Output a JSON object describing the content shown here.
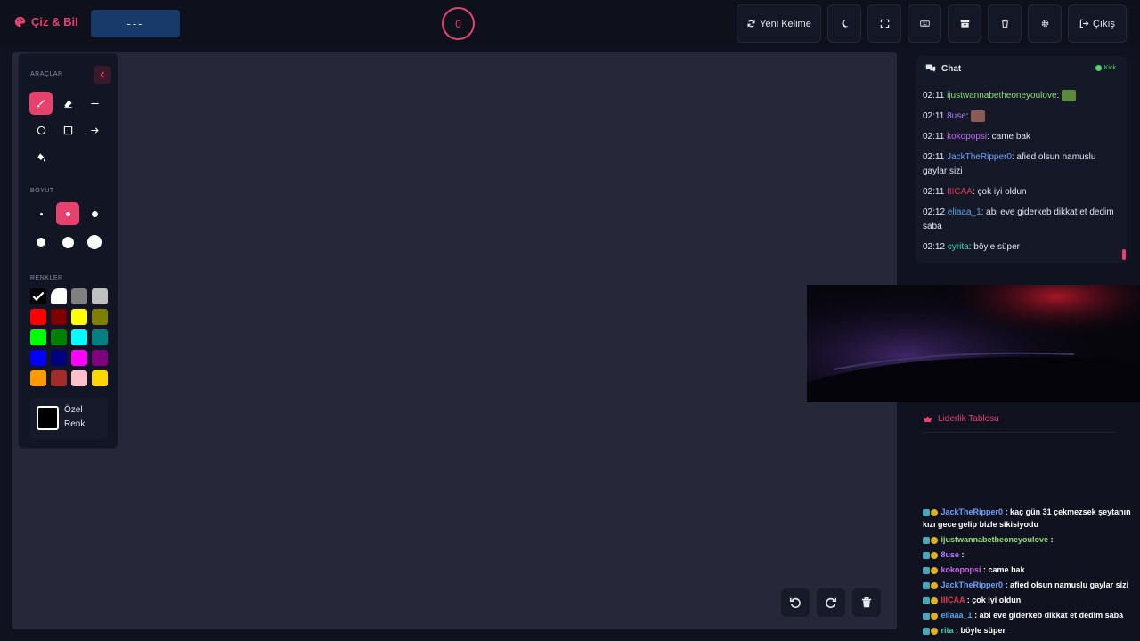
{
  "app": {
    "title": "Çiz & Bil"
  },
  "word": {
    "mask": "---"
  },
  "timer": {
    "value": "0"
  },
  "toolbar": {
    "new_word_label": "Yeni Kelime",
    "exit_label": "Çıkış"
  },
  "panel": {
    "tools_title": "ARAÇLAR",
    "size_title": "BOYUT",
    "colors_title": "RENKLER",
    "custom_color_label": "Özel Renk",
    "tools": [
      "brush-icon",
      "eraser-icon",
      "line-icon",
      "circle-icon",
      "rectangle-icon",
      "arrow-icon",
      "fill-icon"
    ],
    "colors": [
      "#000000",
      "#ffffff",
      "#808080",
      "#c0c0c0",
      "#ff0000",
      "#800000",
      "#ffff00",
      "#808000",
      "#00ff00",
      "#008000",
      "#00ffff",
      "#008080",
      "#0000ff",
      "#000080",
      "#ff00ff",
      "#800080",
      "#ff9900",
      "#a52a2a",
      "#ffc0cb",
      "#ffd700"
    ]
  },
  "chat": {
    "title": "Chat",
    "platform": "Kick",
    "messages": [
      {
        "time": "02:11",
        "user": "ijustwannabetheoneyoulove",
        "text": ":",
        "color": "#8ee07a"
      },
      {
        "time": "02:11",
        "user": "8use",
        "text": ":",
        "color": "#b57bff"
      },
      {
        "time": "02:11",
        "user": "kokopopsi",
        "text": ": came bak",
        "color": "#c56be8"
      },
      {
        "time": "02:11",
        "user": "JackTheRipper0",
        "text": ": afied olsun namuslu gaylar sizi",
        "color": "#6fa3ff"
      },
      {
        "time": "02:11",
        "user": "IIICAA",
        "text": ": çok iyi oldun",
        "color": "#e03b4c"
      },
      {
        "time": "02:12",
        "user": "eliaaa_1",
        "text": ": abi eve giderkeb dikkat et dedim saba",
        "color": "#58a6e8"
      },
      {
        "time": "02:12",
        "user": "cyrita",
        "text": ": böyle süper",
        "color": "#3dd6b0"
      }
    ]
  },
  "leaderboard": {
    "title": "Liderlik Tablosu"
  },
  "overlay_chat": [
    {
      "user": "JackTheRipper0",
      "text": ": kaç gün 31 çekmezsek şeytanın kızı gece gelip bizle sikisiyodu",
      "color": "#6fa3ff"
    },
    {
      "user": "ijustwannabetheoneyoulove",
      "text": ":",
      "color": "#8ee07a"
    },
    {
      "user": "8use",
      "text": ":",
      "color": "#b57bff"
    },
    {
      "user": "kokopopsi",
      "text": ": came bak",
      "color": "#c56be8"
    },
    {
      "user": "JackTheRipper0",
      "text": ": afied olsun namuslu gaylar sizi",
      "color": "#6fa3ff"
    },
    {
      "user": "IIICAA",
      "text": ": çok iyi oldun",
      "color": "#e03b4c"
    },
    {
      "user": "eliaaa_1",
      "text": ": abi eve giderkeb dikkat et dedim saba",
      "color": "#58a6e8"
    },
    {
      "user": "rita",
      "text": ": böyle süper",
      "color": "#3dd6b0"
    }
  ],
  "colors": {
    "accent": "#e8416d",
    "canvas": "#26283a",
    "background": "#10131f"
  }
}
